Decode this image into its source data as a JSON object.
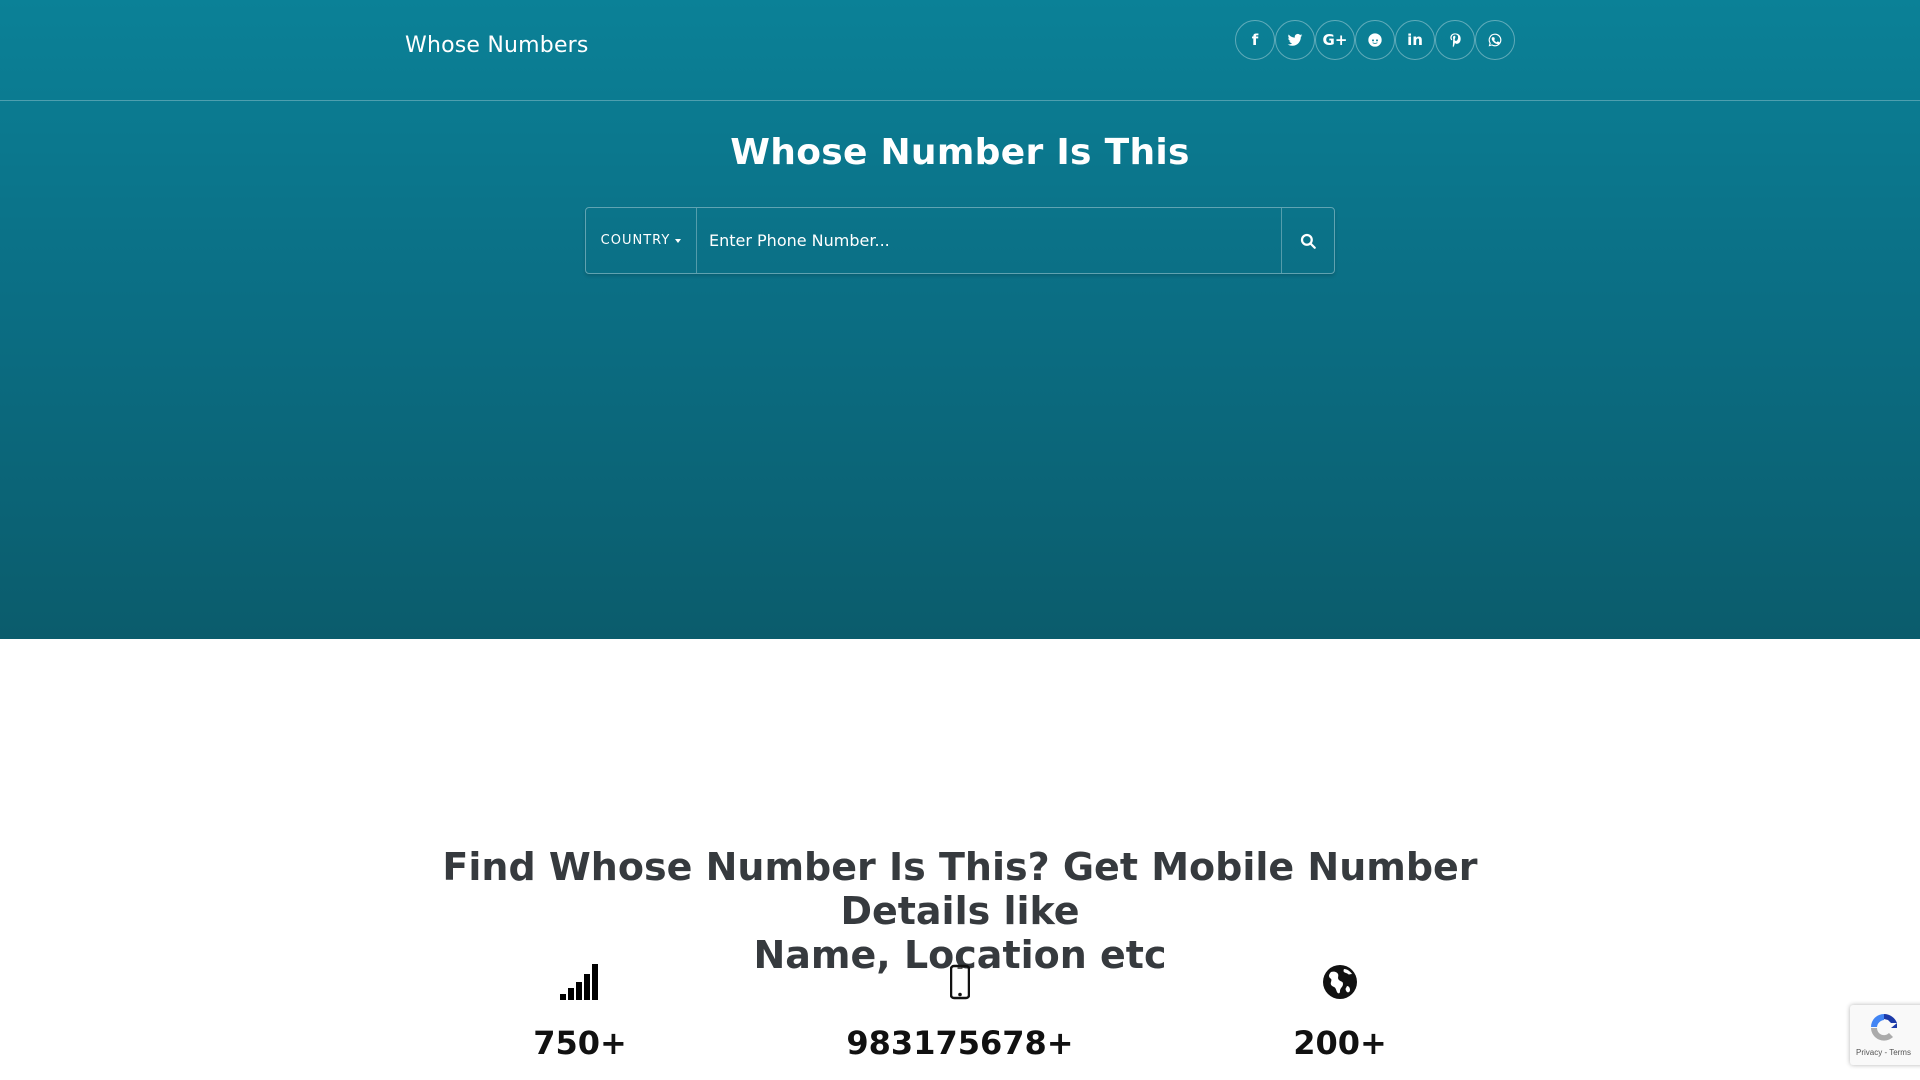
{
  "header": {
    "brand": "Whose Numbers",
    "social": [
      {
        "name": "facebook",
        "icon": "facebook-icon"
      },
      {
        "name": "twitter",
        "icon": "twitter-icon"
      },
      {
        "name": "google-plus",
        "icon": "google-plus-icon"
      },
      {
        "name": "reddit",
        "icon": "reddit-icon"
      },
      {
        "name": "linkedin",
        "icon": "linkedin-icon"
      },
      {
        "name": "pinterest",
        "icon": "pinterest-icon"
      },
      {
        "name": "whatsapp",
        "icon": "whatsapp-icon"
      }
    ],
    "social_glyphs": {
      "facebook": "f",
      "google_plus": "G+",
      "linkedin": "in"
    }
  },
  "hero": {
    "title": "Whose Number Is This",
    "country_label": "COUNTRY",
    "phone_placeholder": "Enter Phone Number...",
    "search_icon": "search-icon"
  },
  "main": {
    "headline_line1": "Find Whose Number Is This? Get Mobile Number Details like",
    "headline_line2": "Name, Location etc",
    "stats": [
      {
        "icon": "signal-icon",
        "value": "750+"
      },
      {
        "icon": "mobile-phone-icon",
        "value": "983175678+"
      },
      {
        "icon": "globe-icon",
        "value": "200+"
      }
    ]
  },
  "recaptcha": {
    "links": "Privacy - Terms"
  },
  "colors": {
    "hero_top": "#0b8197",
    "hero_bottom": "#0b5c6c",
    "headline_text": "#363a3e"
  }
}
